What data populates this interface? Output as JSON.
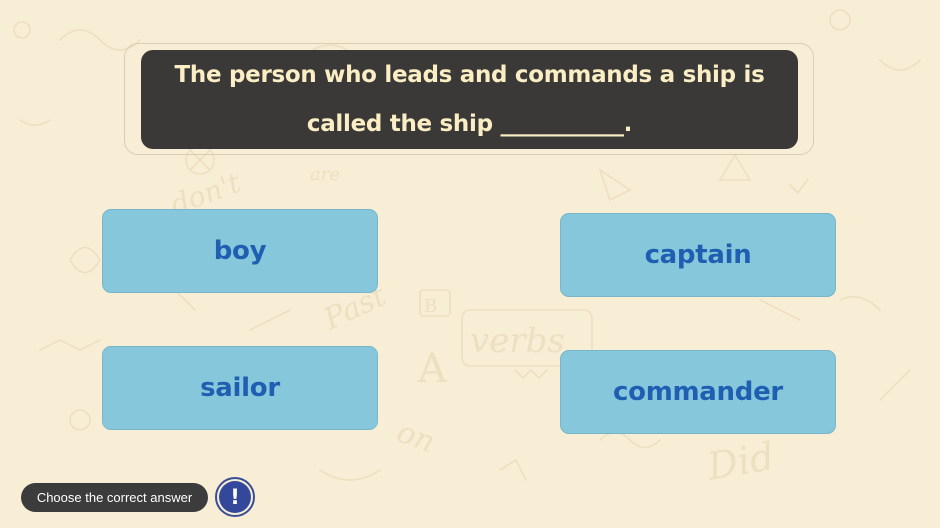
{
  "question": {
    "line1": "The person who leads and commands a ship is",
    "line2": "called the ship ___________."
  },
  "answers": [
    {
      "label": "boy"
    },
    {
      "label": "captain"
    },
    {
      "label": "sailor"
    },
    {
      "label": "commander"
    }
  ],
  "footer": {
    "instruction": "Choose the correct answer",
    "hint_icon": "!"
  },
  "background": {
    "doodle_words": [
      "don't",
      "are",
      "Past",
      "verbs",
      "on",
      "Did",
      "B",
      "A"
    ]
  },
  "colors": {
    "background": "#f8eed5",
    "question_card": "#3a3937",
    "question_text": "#fbeec4",
    "answer_fill": "#87c7db",
    "answer_text": "#1f5fb2",
    "hint_button": "#33489b"
  }
}
